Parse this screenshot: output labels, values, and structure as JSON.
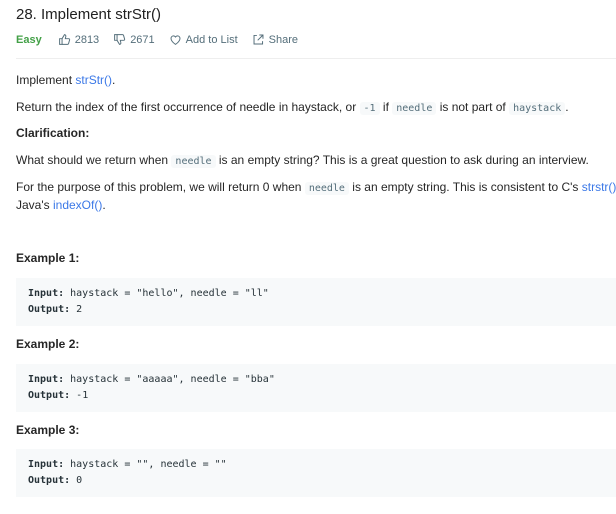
{
  "header": {
    "title": "28. Implement strStr()",
    "difficulty": "Easy",
    "likes": "2813",
    "dislikes": "2671",
    "add_to_list": "Add to List",
    "share": "Share"
  },
  "description": {
    "intro_prefix": "Implement ",
    "intro_link": "strStr()",
    "intro_suffix": ".",
    "line2_a": "Return the index of the first occurrence of needle in haystack, or ",
    "line2_code1": "-1",
    "line2_b": " if ",
    "line2_code2": "needle",
    "line2_c": " is not part of ",
    "line2_code3": "haystack",
    "line2_d": ".",
    "clarification_heading": "Clarification:",
    "clar_a": "What should we return when ",
    "clar_code": "needle",
    "clar_b": " is an empty string? This is a great question to ask during an interview.",
    "purpose_a": "For the purpose of this problem, we will return 0 when ",
    "purpose_code": "needle",
    "purpose_b": " is an empty string. This is consistent to C's ",
    "purpose_link1": "strstr()",
    "purpose_c": " and",
    "purpose_d": "Java's ",
    "purpose_link2": "indexOf()",
    "purpose_e": "."
  },
  "examples": [
    {
      "heading": "Example 1:",
      "input_label": "Input:",
      "input": " haystack = \"hello\", needle = \"ll\"",
      "output_label": "Output:",
      "output": " 2"
    },
    {
      "heading": "Example 2:",
      "input_label": "Input:",
      "input": " haystack = \"aaaaa\", needle = \"bba\"",
      "output_label": "Output:",
      "output": " -1"
    },
    {
      "heading": "Example 3:",
      "input_label": "Input:",
      "input": " haystack = \"\", needle = \"\"",
      "output_label": "Output:",
      "output": " 0"
    }
  ]
}
